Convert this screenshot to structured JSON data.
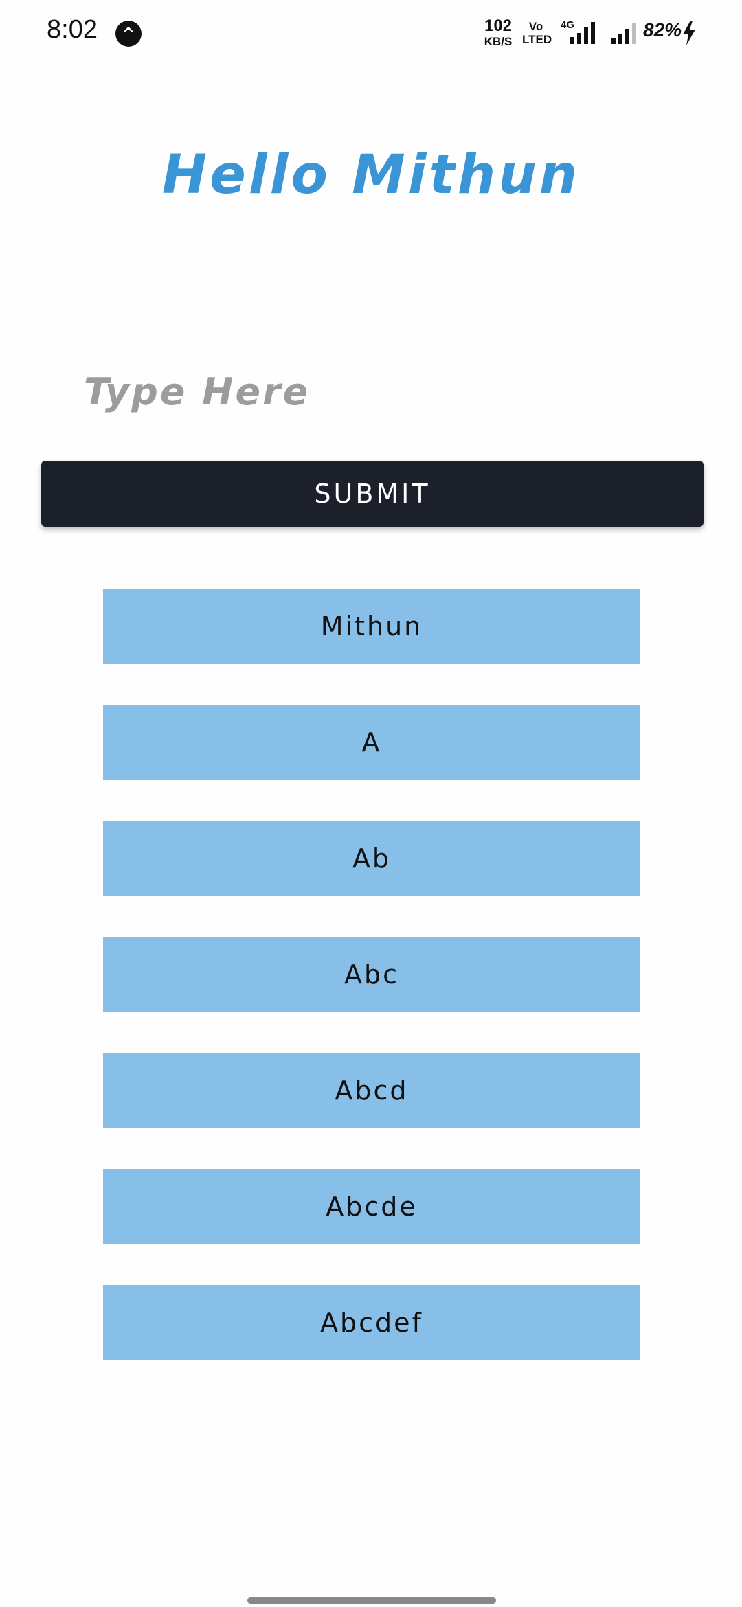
{
  "status_bar": {
    "time": "8:02",
    "app_badge_glyph": "^",
    "net_speed_value": "102",
    "net_speed_unit": "KB/S",
    "volte_top": "Vo",
    "volte_bottom": "LTED",
    "network_type": "4G",
    "battery": "82%",
    "icons": [
      "app-notification-icon",
      "signal-strength-icon",
      "signal-strength-icon",
      "charging-bolt-icon"
    ]
  },
  "main": {
    "headline": "Hello Mithun",
    "input": {
      "placeholder": "Type Here",
      "value": ""
    },
    "submit_label": "SUBMIT",
    "items": [
      "Mithun",
      "A",
      "Ab",
      "Abc",
      "Abcd",
      "Abcde",
      "Abcdef"
    ]
  },
  "colors": {
    "headline": "#3a95d6",
    "submit_bg": "#1b202b",
    "item_bg": "#87bfe8",
    "placeholder": "#9c9c9c"
  }
}
